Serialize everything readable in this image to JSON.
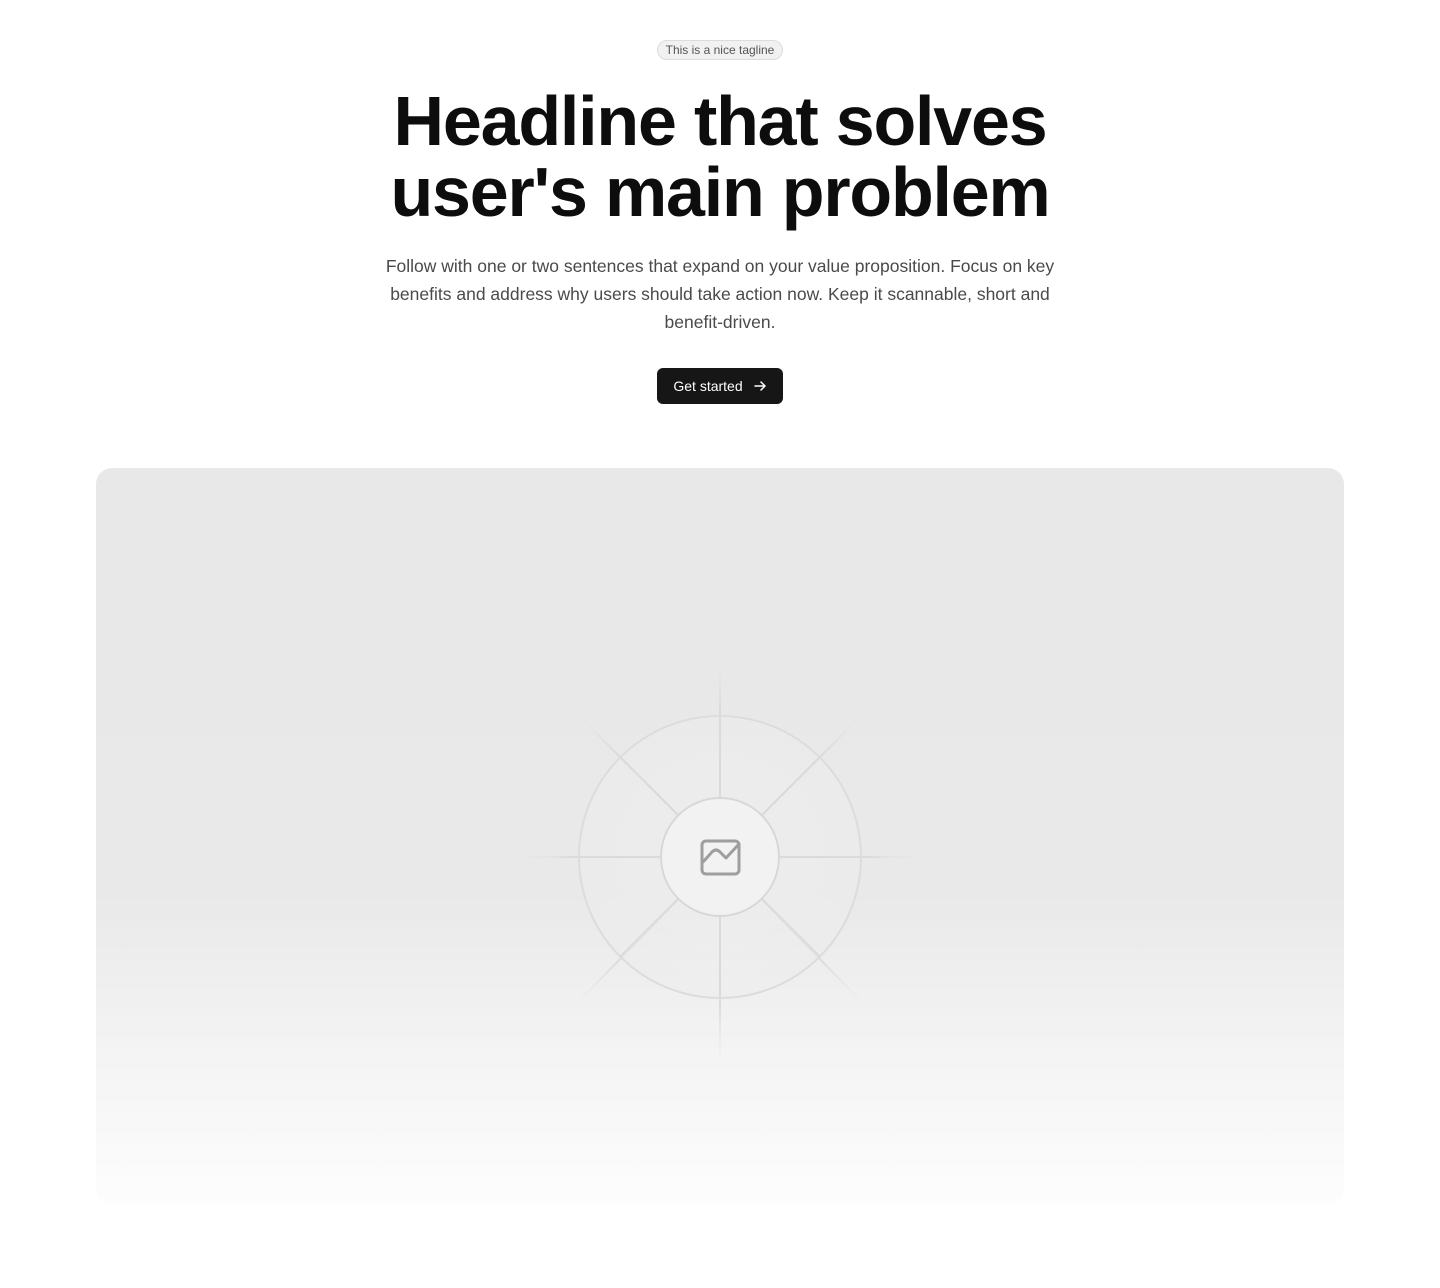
{
  "hero": {
    "tagline": "This is a nice tagline",
    "headline": "Headline that solves user's main problem",
    "subtext": "Follow with one or two sentences that expand on your value proposition. Focus on key benefits and address why users should take action now. Keep it scannable, short and benefit-driven.",
    "cta_label": "Get started",
    "cta_icon": "arrow-right-icon"
  },
  "media": {
    "placeholder_icon": "image-icon"
  },
  "colors": {
    "cta_background": "#161616",
    "cta_text": "#ffffff",
    "media_background": "#e8e8e8",
    "headline": "#0d0d0d",
    "body_text": "#4a4a4a"
  }
}
